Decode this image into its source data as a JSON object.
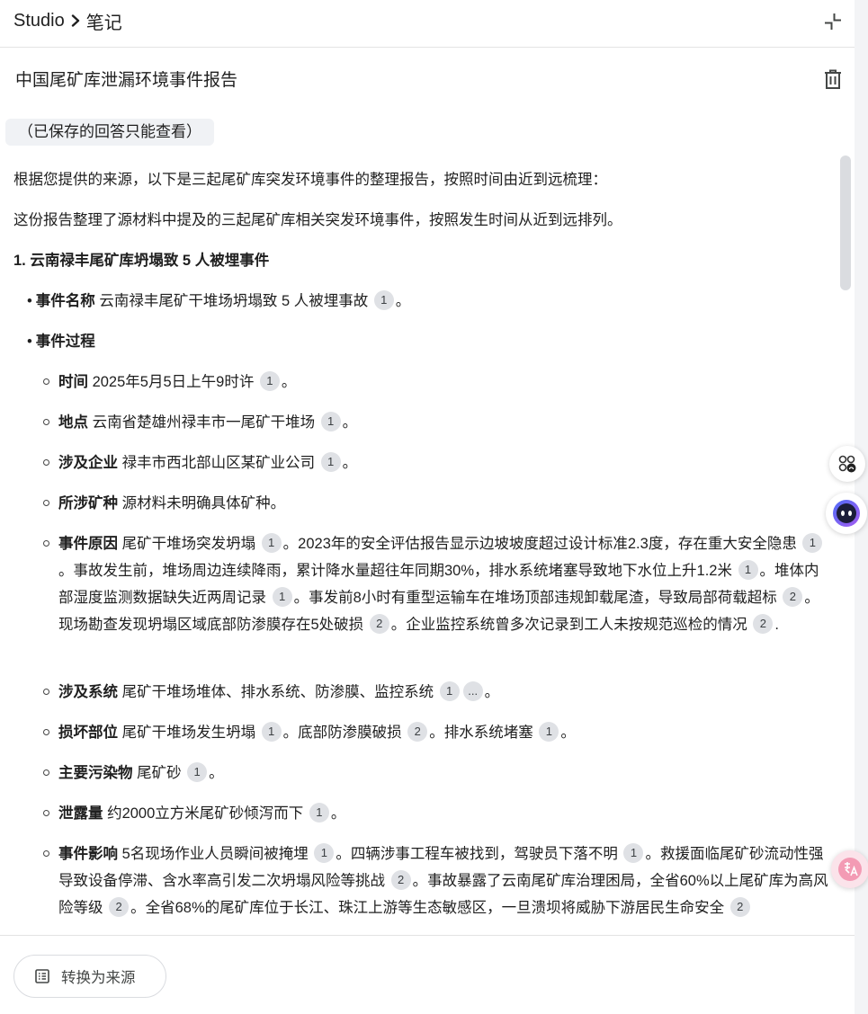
{
  "header": {
    "crumb_root": "Studio",
    "crumb_current": "笔记"
  },
  "note": {
    "title": "中国尾矿库泄漏环境事件报告",
    "saved_tag": "（已保存的回答只能查看）"
  },
  "body": {
    "intro1": "根据您提供的来源，以下是三起尾矿库突发环境事件的整理报告，按照时间由近到远梳理：",
    "intro2": "这份报告整理了源材料中提及的三起尾矿库相关突发环境事件，按照发生时间从近到远排列。",
    "section1_title": "1. 云南禄丰尾矿库坍塌致 5 人被埋事件",
    "event_name_label": "事件名称",
    "event_name_text": " 云南禄丰尾矿干堆场坍塌致 5 人被埋事故 ",
    "event_process_label": "事件过程",
    "time_label": "时间",
    "time_text": " 2025年5月5日上午9时许 ",
    "location_label": "地点",
    "location_text": " 云南省楚雄州禄丰市一尾矿干堆场 ",
    "company_label": "涉及企业",
    "company_text": " 禄丰市西北部山区某矿业公司 ",
    "mineral_label": "所涉矿种",
    "mineral_text": " 源材料未明确具体矿种。",
    "cause_label": "事件原因",
    "cause_t1": " 尾矿干堆场突发坍塌 ",
    "cause_t2": "。2023年的安全评估报告显示边坡坡度超过设计标准2.3度，存在重大安全隐患 ",
    "cause_t3": "。事故发生前，堆场周边连续降雨，累计降水量超往年同期30%，排水系统堵塞导致地下水位上升1.2米 ",
    "cause_t4": "。堆体内部湿度监测数据缺失近两周记录 ",
    "cause_t5": "。事发前8小时有重型运输车在堆场顶部违规卸载尾渣，导致局部荷载超标 ",
    "cause_t6": "。现场勘查发现坍塌区域底部防渗膜存在5处破损 ",
    "cause_t7": "。企业监控系统曾多次记录到工人未按规范巡检的情况 ",
    "systems_label": "涉及系统",
    "systems_text": " 尾矿干堆场堆体、排水系统、防渗膜、监控系统 ",
    "damage_label": "损坏部位",
    "damage_t1": " 尾矿干堆场发生坍塌 ",
    "damage_t2": "。底部防渗膜破损 ",
    "damage_t3": "。排水系统堵塞 ",
    "pollutant_label": "主要污染物",
    "pollutant_text": " 尾矿砂 ",
    "leak_label": "泄露量",
    "leak_text": " 约2000立方米尾矿砂倾泻而下 ",
    "impact_label": "事件影响",
    "impact_t1": " 5名现场作业人员瞬间被掩埋 ",
    "impact_t2": "。四辆涉事工程车被找到，驾驶员下落不明 ",
    "impact_t3": "。救援面临尾矿砂流动性强导致设备停滞、含水率高引发二次坍塌风险等挑战 ",
    "impact_t4": "。事故暴露了云南尾矿库治理困局，全省60%以上尾矿库为高风险等级 ",
    "impact_t5": "。全省68%的尾矿库位于长江、珠江上游等生态敏感区，一旦溃坝将威胁下游居民生命安全 ",
    "period": "。",
    "period_en": ".",
    "cite1": "1",
    "cite2": "2",
    "cite_more": "..."
  },
  "footer": {
    "convert_label": "转换为来源"
  },
  "icons": {
    "collapse": "collapse-icon",
    "delete": "trash-icon",
    "convert": "note-convert-icon"
  }
}
